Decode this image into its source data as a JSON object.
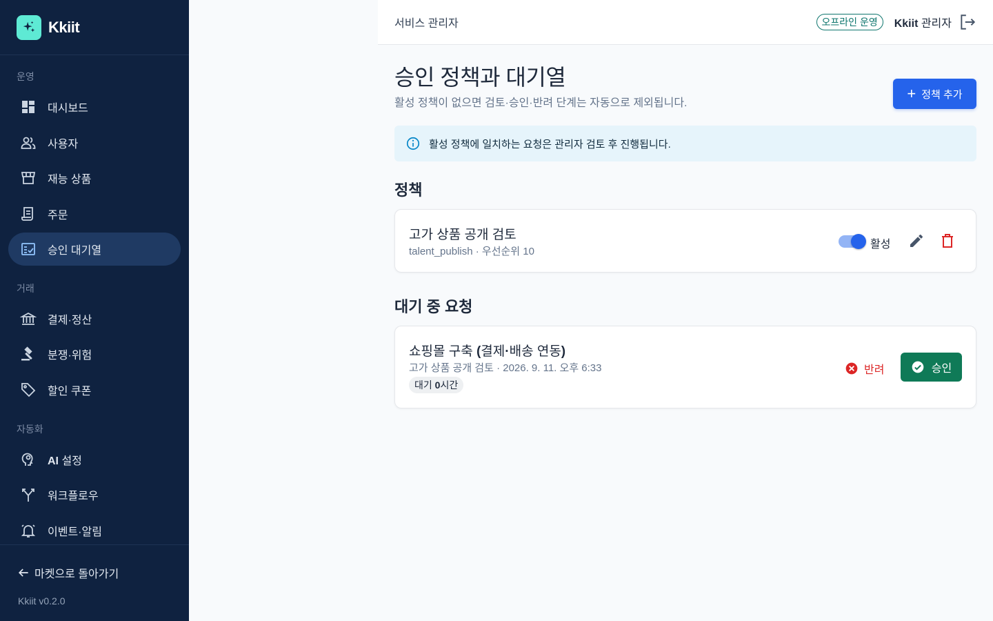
{
  "brand": {
    "name": "Kkiit",
    "icon": "sparkle-icon"
  },
  "sidebar": {
    "sections": [
      {
        "label": "운영"
      },
      {
        "label": "거래"
      },
      {
        "label": "자동화"
      }
    ],
    "items": [
      {
        "label": "대시보드",
        "icon": "dashboard-icon"
      },
      {
        "label": "사용자",
        "icon": "users-icon"
      },
      {
        "label": "재능 상품",
        "icon": "store-icon"
      },
      {
        "label": "주문",
        "icon": "receipt-icon"
      },
      {
        "label": "승인 대기열",
        "icon": "approval-queue-icon",
        "active": true
      },
      {
        "label": "결제·정산",
        "icon": "bank-icon"
      },
      {
        "label": "분쟁·위험",
        "icon": "gavel-icon"
      },
      {
        "label": "할인 쿠폰",
        "icon": "tag-icon"
      },
      {
        "label_bold": "AI",
        "label": " 설정",
        "icon": "psychology-icon"
      },
      {
        "label": "워크플로우",
        "icon": "merge-icon"
      },
      {
        "label": "이벤트·알림",
        "icon": "alarm-bell-icon"
      }
    ],
    "back_label": "마켓으로 돌아가기",
    "version": "Kkiit v0.2.0"
  },
  "header": {
    "title": "서비스 관리자",
    "status": "오프라인 운영",
    "user_brand": "Kkiit",
    "user_role": " 관리자"
  },
  "page": {
    "title": "승인 정책과 대기열",
    "subtitle": "활성 정책이 없으면 검토·승인·반려 단계는 자동으로 제외됩니다.",
    "add_button": "정책 추가",
    "info": "활성 정책에 일치하는 요청은 관리자 검토 후 진행됩니다."
  },
  "policies": {
    "section_title": "정책",
    "items": [
      {
        "title": "고가 상품 공개 검토",
        "meta": "talent_publish · 우선순위 10",
        "toggle_label": "활성",
        "enabled": true
      }
    ]
  },
  "requests": {
    "section_title": "대기 중 요청",
    "items": [
      {
        "title_prefix": "쇼핑몰 구축 ",
        "title_bold": "(",
        "title_mid": "결제",
        "title_dot": "·",
        "title_rest": "배송 연동",
        "title_end": ")",
        "meta": "고가 상품 공개 검토 · 2026. 9. 11. 오후 6:33",
        "wait_prefix": "대기 ",
        "wait_value": "0",
        "wait_suffix": "시간",
        "reject_label": "반려",
        "approve_label": "승인"
      }
    ]
  },
  "colors": {
    "sidebar_bg": "#0f2240",
    "active_bg": "#1f3a63",
    "primary": "#2563eb",
    "approve": "#0f7a57",
    "reject": "#dc2626",
    "status": "#0f766e"
  }
}
